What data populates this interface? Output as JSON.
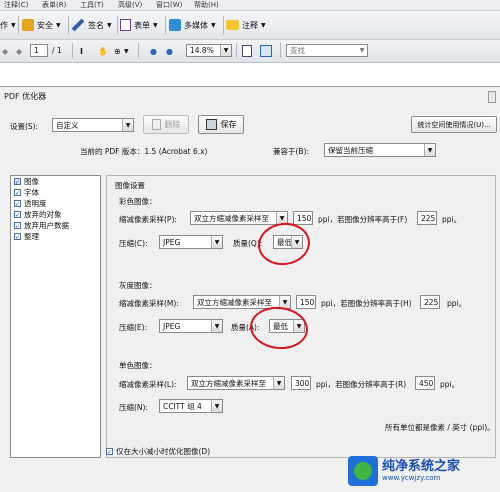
{
  "menubar": {
    "items": [
      "注释(C)",
      "表单(R)",
      "工具(T)",
      "高级(V)",
      "窗口(W)",
      "帮助(H)"
    ]
  },
  "toolbar1": {
    "create": "作",
    "security": "安全",
    "sign": "签名",
    "forms": "表单",
    "multimedia": "多媒体",
    "comment": "注释"
  },
  "toolbar2": {
    "page": "1",
    "page_total": "/ 1",
    "zoom": "14.8%",
    "find_placeholder": "查找"
  },
  "dialog": {
    "title": "PDF 优化器",
    "settings_label": "设置(S):",
    "settings_value": "自定义",
    "delete_label": "删除",
    "save_label": "保存",
    "space_audit": "统计空间使用情况(U)...",
    "version_text": "当前的 PDF 版本：1.5 (Acrobat 6.x)",
    "compat_label": "兼容于(B):",
    "compat_value": "保留当前压缩",
    "categories": [
      {
        "label": "图像",
        "checked": true,
        "selected": true
      },
      {
        "label": "字体",
        "checked": true,
        "selected": false
      },
      {
        "label": "透明度",
        "checked": true,
        "selected": false
      },
      {
        "label": "放弃的对象",
        "checked": true,
        "selected": false
      },
      {
        "label": "放弃用户数据",
        "checked": true,
        "selected": false
      },
      {
        "label": "整理",
        "checked": true,
        "selected": false
      }
    ],
    "image_settings_title": "图像设置",
    "color": {
      "title": "彩色图像：",
      "downsample_label": "缩减像素采样(P):",
      "downsample_value": "双立方缩减像素采样至",
      "ppi": "150",
      "above_text": "ppi，若图像分辨率高于(F)",
      "above_value": "225",
      "ppi_unit": "ppi。",
      "compress_label": "压缩(C):",
      "compress_value": "JPEG",
      "quality_label": "质量(Q):",
      "quality_value": "最低"
    },
    "gray": {
      "title": "灰度图像：",
      "downsample_label": "缩减像素采样(M):",
      "downsample_value": "双立方缩减像素采样至",
      "ppi": "150",
      "above_text": "ppi，若图像分辨率高于(H)",
      "above_value": "225",
      "ppi_unit": "ppi。",
      "compress_label": "压缩(E):",
      "compress_value": "JPEG",
      "quality_label": "质量(A):",
      "quality_value": "最低"
    },
    "mono": {
      "title": "单色图像：",
      "downsample_label": "缩减像素采样(L):",
      "downsample_value": "双立方缩减像素采样至",
      "ppi": "300",
      "above_text": "ppi，若图像分辨率高于(R)",
      "above_value": "450",
      "ppi_unit": "ppi。",
      "compress_label": "压缩(N):",
      "compress_value": "CCITT 组 4"
    },
    "unit_note": "所有单位都是像素 / 英寸 (ppi)。",
    "optimize_only_smaller": "仅在大小减小时优化图像(D)"
  },
  "watermark": {
    "name": "纯净系统之家",
    "url": "www.ycwjzy.com"
  },
  "colors": {
    "annotation": "#d9141c",
    "accent": "#1f6fd8"
  }
}
